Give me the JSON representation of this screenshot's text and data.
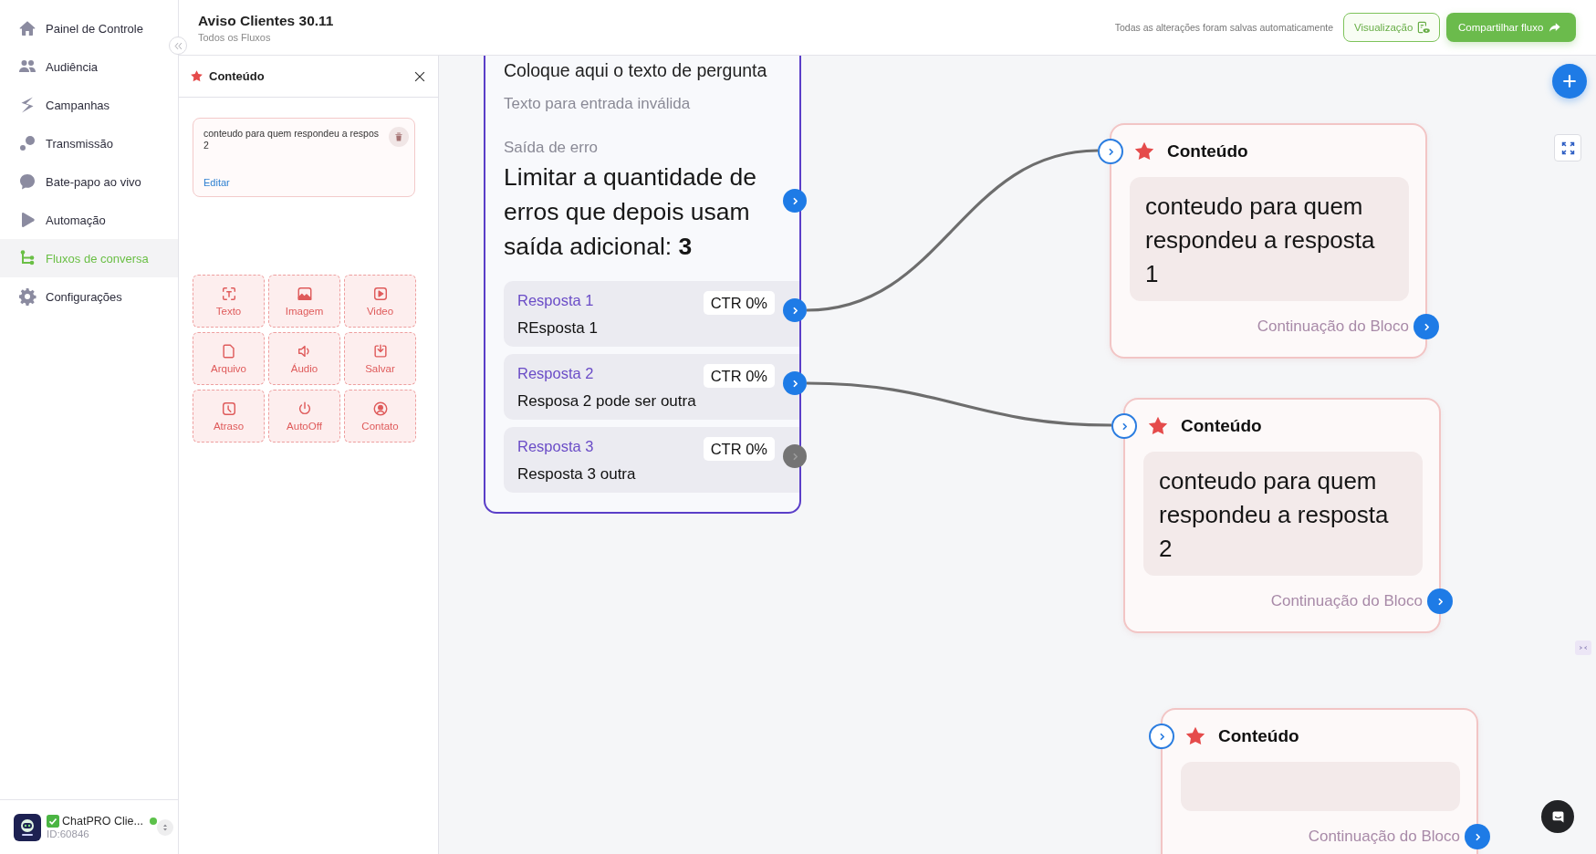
{
  "sidebar": {
    "items": [
      {
        "label": "Painel de Controle",
        "selected": false
      },
      {
        "label": "Audiência",
        "selected": false
      },
      {
        "label": "Campanhas",
        "selected": false
      },
      {
        "label": "Transmissão",
        "selected": false
      },
      {
        "label": "Bate-papo ao vivo",
        "selected": false
      },
      {
        "label": "Automação",
        "selected": false
      },
      {
        "label": "Fluxos de conversa",
        "selected": true
      },
      {
        "label": "Configurações",
        "selected": false
      }
    ],
    "account": {
      "name": "ChatPRO Clie...",
      "id": "ID:60846",
      "online": true
    }
  },
  "header": {
    "title": "Aviso Clientes 30.11",
    "breadcrumb": "Todos os Fluxos",
    "save_status": "Todas as alterações foram salvas automaticamente",
    "buttons": [
      {
        "label": "Visualização",
        "kind": "outline"
      },
      {
        "label": "Compartilhar fluxo",
        "kind": "primary"
      }
    ]
  },
  "panel": {
    "title": "Conteúdo",
    "message": {
      "text": "conteudo para quem respondeu a respos\n2",
      "action": "Editar"
    },
    "tools": [
      "Texto",
      "Imagem",
      "Video",
      "Arquivo",
      "Áudio",
      "Salvar",
      "Atraso",
      "AutoOff",
      "Contato"
    ]
  },
  "canvas": {
    "question_node": {
      "question": "Coloque aqui o texto de pergunta",
      "invalid_input_text": "Texto para entrada inválida",
      "error_output_label": "Saída de erro",
      "error_limit_text": "Limitar a quantidade de erros que depois usam saída adicional: **3**",
      "answers": [
        {
          "title": "Resposta 1",
          "ctr": "CTR 0%",
          "text": "REsposta 1",
          "linked": true
        },
        {
          "title": "Resposta 2",
          "ctr": "CTR 0%",
          "text": "Resposa 2 pode ser outra",
          "linked": true
        },
        {
          "title": "Resposta 3",
          "ctr": "CTR 0%",
          "text": "Resposta 3 outra",
          "linked": false
        }
      ]
    },
    "content_nodes": [
      {
        "title": "Conteúdo",
        "text": "conteudo para quem respondeu a resposta 1",
        "footer": "Continuação do Bloco"
      },
      {
        "title": "Conteúdo",
        "text": "conteudo para quem respondeu a resposta 2",
        "footer": "Continuação do Bloco"
      },
      {
        "title": "Conteúdo",
        "footer": "Continuação do Bloco"
      }
    ]
  }
}
